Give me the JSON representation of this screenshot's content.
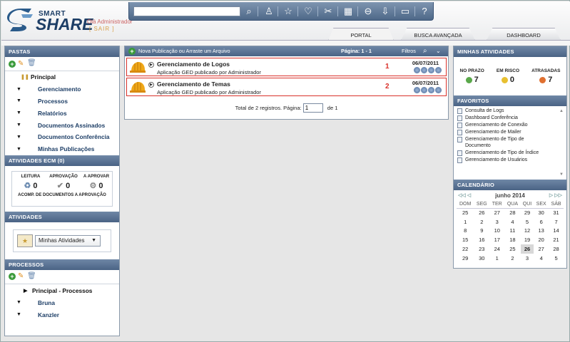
{
  "header": {
    "logo_smart": "SMART",
    "logo_share": "SHARE",
    "greeting": "Olá Administrador",
    "exit": "[ SAIR ]",
    "search": {
      "value": "",
      "placeholder": ""
    },
    "tabs": [
      {
        "label": "PORTAL"
      },
      {
        "label": "BUSCA AVANÇADA"
      },
      {
        "label": "DASHBOARD"
      }
    ]
  },
  "pastas": {
    "title": "PASTAS",
    "root": "Principal",
    "items": [
      "Gerenciamento",
      "Processos",
      "Relatórios",
      "Documentos Assinados",
      "Documentos Conferência",
      "Minhas Publicações"
    ]
  },
  "ecm": {
    "title": "ATIVIDADES ECM (0)",
    "counters": [
      {
        "label": "LEITURA",
        "value": "0"
      },
      {
        "label": "APROVAÇÃO",
        "value": "0"
      },
      {
        "label": "A APROVAR",
        "value": "0"
      }
    ],
    "acomp": "ACOMP. DE DOCUMENTOS A APROVAÇÃO"
  },
  "atividades": {
    "title": "ATIVIDADES",
    "select": "Minhas Atividades"
  },
  "processos": {
    "title": "PROCESSOS",
    "root": "Principal - Processos",
    "items": [
      "Bruna",
      "Kanzler"
    ]
  },
  "center": {
    "new_pub": "Nova Publicação ou Arraste um Arquivo",
    "page": "Página:  1 - 1",
    "filters": "Filtros",
    "rows": [
      {
        "title": "Gerenciamento de Logos",
        "sub": "Aplicação GED publicado por Administrador",
        "num": "1",
        "date": "06/07/2011"
      },
      {
        "title": "Gerenciamento de Temas",
        "sub": "Aplicação GED publicado por Administrador",
        "num": "2",
        "date": "06/07/2011"
      }
    ],
    "total": "Total de 2 registros. Página:",
    "page_value": "1",
    "of": "de 1"
  },
  "minhas": {
    "title": "MINHAS ATIVIDADES",
    "stats": [
      {
        "label": "NO PRAZO",
        "value": "7",
        "color": "#5aa84a"
      },
      {
        "label": "EM RISCO",
        "value": "0",
        "color": "#e8c030"
      },
      {
        "label": "ATRASADAS",
        "value": "7",
        "color": "#e07030"
      }
    ]
  },
  "favoritos": {
    "title": "FAVORITOS",
    "items": [
      "Consulta de Logs",
      "Dashboard Conferência",
      "Gerenciamento de Conexão",
      "Gerenciamento de Mailer",
      "Gerenciamento de Tipo de Documento",
      "Gerenciamento de Tipo de Índice",
      "Gerenciamento de Usuários"
    ]
  },
  "calendario": {
    "title": "CALENDÁRIO",
    "month": "junho 2014",
    "prev": "◁◁ ◁",
    "next": "▷ ▷▷",
    "days": [
      "DOM",
      "SEG",
      "TER",
      "QUA",
      "QUI",
      "SEX",
      "SÁB"
    ],
    "weeks": [
      [
        "25",
        "26",
        "27",
        "28",
        "29",
        "30",
        "31"
      ],
      [
        "1",
        "2",
        "3",
        "4",
        "5",
        "6",
        "7"
      ],
      [
        "8",
        "9",
        "10",
        "11",
        "12",
        "13",
        "14"
      ],
      [
        "15",
        "16",
        "17",
        "18",
        "19",
        "20",
        "21"
      ],
      [
        "22",
        "23",
        "24",
        "25",
        "26",
        "27",
        "28"
      ],
      [
        "29",
        "30",
        "1",
        "2",
        "3",
        "4",
        "5"
      ]
    ],
    "today": "26"
  }
}
